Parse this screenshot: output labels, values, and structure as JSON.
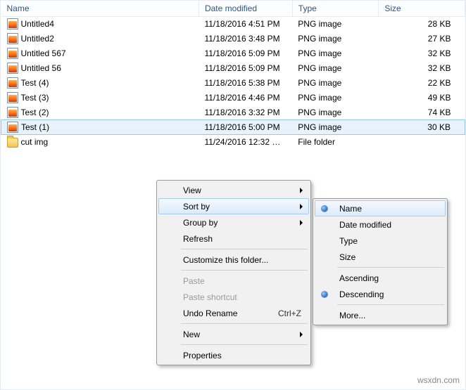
{
  "columns": {
    "name": "Name",
    "date": "Date modified",
    "type": "Type",
    "size": "Size"
  },
  "files": [
    {
      "name": "Untitled4",
      "date": "11/18/2016 4:51 PM",
      "type": "PNG image",
      "size": "28 KB",
      "icon": "png",
      "selected": false
    },
    {
      "name": "Untitled2",
      "date": "11/18/2016 3:48 PM",
      "type": "PNG image",
      "size": "27 KB",
      "icon": "png",
      "selected": false
    },
    {
      "name": "Untitled 567",
      "date": "11/18/2016 5:09 PM",
      "type": "PNG image",
      "size": "32 KB",
      "icon": "png",
      "selected": false
    },
    {
      "name": "Untitled 56",
      "date": "11/18/2016 5:09 PM",
      "type": "PNG image",
      "size": "32 KB",
      "icon": "png",
      "selected": false
    },
    {
      "name": "Test (4)",
      "date": "11/18/2016 5:38 PM",
      "type": "PNG image",
      "size": "22 KB",
      "icon": "png",
      "selected": false
    },
    {
      "name": "Test (3)",
      "date": "11/18/2016 4:46 PM",
      "type": "PNG image",
      "size": "49 KB",
      "icon": "png",
      "selected": false
    },
    {
      "name": "Test (2)",
      "date": "11/18/2016 3:32 PM",
      "type": "PNG image",
      "size": "74 KB",
      "icon": "png",
      "selected": false
    },
    {
      "name": "Test (1)",
      "date": "11/18/2016 5:00 PM",
      "type": "PNG image",
      "size": "30 KB",
      "icon": "png",
      "selected": true
    },
    {
      "name": "cut img",
      "date": "11/24/2016 12:32 …",
      "type": "File folder",
      "size": "",
      "icon": "folder",
      "selected": false
    }
  ],
  "context_menu": {
    "view": "View",
    "sort_by": "Sort by",
    "group_by": "Group by",
    "refresh": "Refresh",
    "customize": "Customize this folder...",
    "paste": "Paste",
    "paste_shortcut": "Paste shortcut",
    "undo_rename": "Undo Rename",
    "undo_rename_shortcut": "Ctrl+Z",
    "new": "New",
    "properties": "Properties"
  },
  "sort_submenu": {
    "name": "Name",
    "date": "Date modified",
    "type": "Type",
    "size": "Size",
    "ascending": "Ascending",
    "descending": "Descending",
    "more": "More..."
  },
  "watermark": "wsxdn.com"
}
